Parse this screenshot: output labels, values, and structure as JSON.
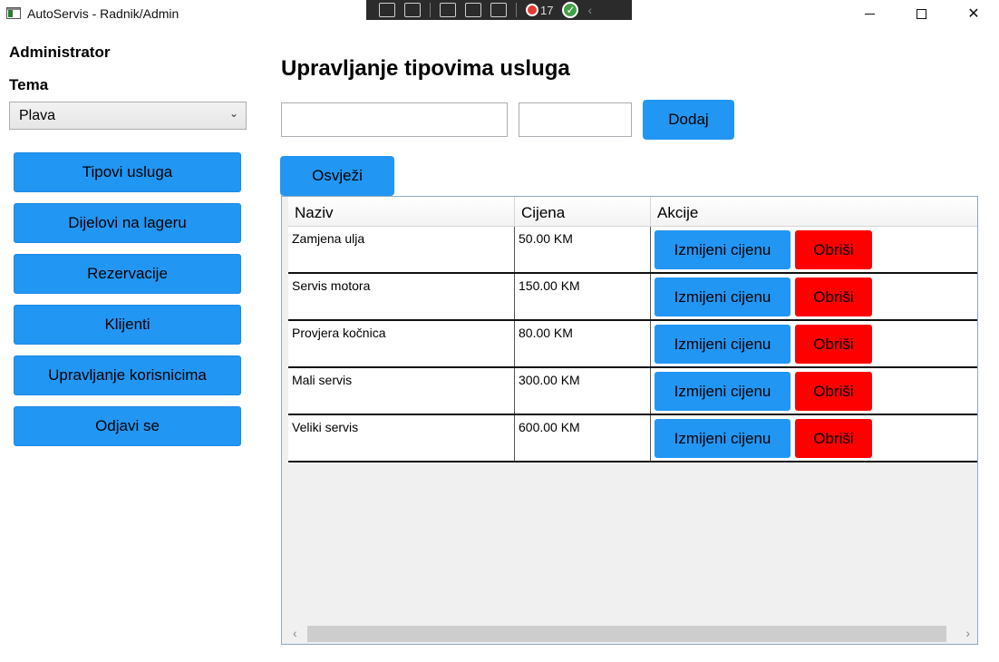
{
  "window": {
    "title": "AutoServis - Radnik/Admin",
    "minimize_icon": "minimize-icon",
    "maximize_icon": "maximize-icon",
    "close_icon": "close-icon"
  },
  "debug_toolbar": {
    "error_count": "17"
  },
  "sidebar": {
    "role": "Administrator",
    "theme_label": "Tema",
    "theme_selected": "Plava",
    "items": [
      {
        "label": "Tipovi usluga"
      },
      {
        "label": "Dijelovi na lageru"
      },
      {
        "label": "Rezervacije"
      },
      {
        "label": "Klijenti"
      },
      {
        "label": "Upravljanje korisnicima"
      },
      {
        "label": "Odjavi se"
      }
    ]
  },
  "main": {
    "title": "Upravljanje tipovima usluga",
    "name_input_value": "",
    "price_input_value": "",
    "add_label": "Dodaj",
    "refresh_label": "Osvježi",
    "columns": [
      "Naziv",
      "Cijena",
      "Akcije"
    ],
    "rows": [
      {
        "name": "Zamjena ulja",
        "price": "50.00 KM",
        "edit": "Izmijeni cijenu",
        "delete": "Obriši"
      },
      {
        "name": "Servis motora",
        "price": "150.00 KM",
        "edit": "Izmijeni cijenu",
        "delete": "Obriši"
      },
      {
        "name": "Provjera kočnica",
        "price": "80.00 KM",
        "edit": "Izmijeni cijenu",
        "delete": "Obriši"
      },
      {
        "name": "Mali servis",
        "price": "300.00 KM",
        "edit": "Izmijeni cijenu",
        "delete": "Obriši"
      },
      {
        "name": "Veliki servis",
        "price": "600.00 KM",
        "edit": "Izmijeni cijenu",
        "delete": "Obriši"
      }
    ]
  },
  "colors": {
    "accent_blue": "#2196f3",
    "delete_red": "#ff0000"
  }
}
